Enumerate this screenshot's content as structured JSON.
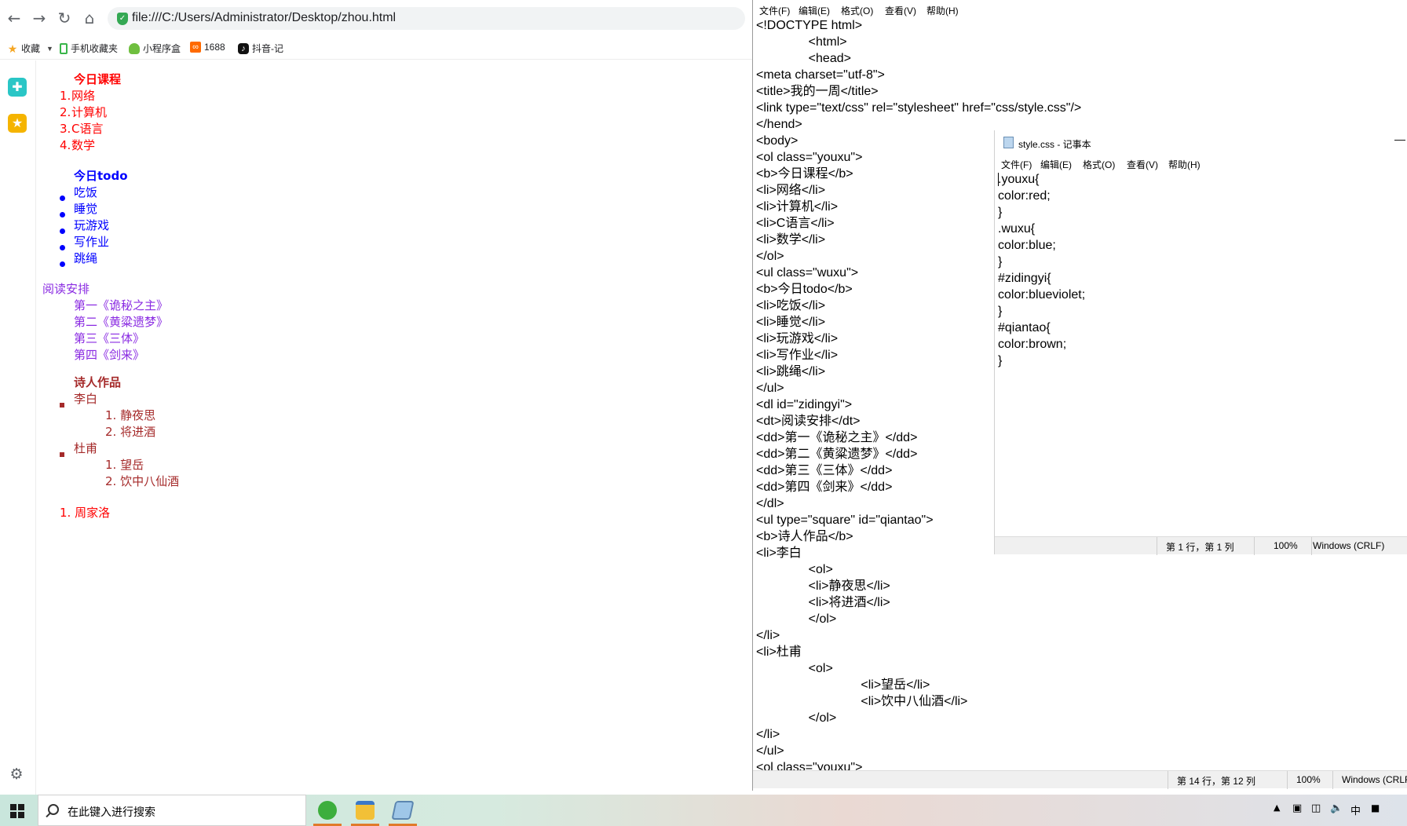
{
  "browser": {
    "url": "file:///C:/Users/Administrator/Desktop/zhou.html",
    "bookmarks": [
      "收藏",
      "手机收藏夹",
      "小程序盒",
      "1688",
      "抖音-记"
    ]
  },
  "rendered": {
    "course": {
      "title": "今日课程",
      "items": [
        {
          "marker": "1.",
          "text": "网络"
        },
        {
          "marker": "2.",
          "text": "计算机"
        },
        {
          "marker": "3.",
          "text": "C语言"
        },
        {
          "marker": "4.",
          "text": "数学"
        }
      ]
    },
    "todo": {
      "title": "今日todo",
      "items": [
        "吃饭",
        "睡觉",
        "玩游戏",
        "写作业",
        "跳绳"
      ]
    },
    "reading": {
      "title": "阅读安排",
      "items": [
        "第一《诡秘之主》",
        "第二《黄粱遗梦》",
        "第三《三体》",
        "第四《剑来》"
      ]
    },
    "poets": {
      "title": "诗人作品",
      "poet1": {
        "name": "李白",
        "works": [
          {
            "marker": "1.",
            "text": "静夜思"
          },
          {
            "marker": "2.",
            "text": "将进酒"
          }
        ]
      },
      "poet2": {
        "name": "杜甫",
        "works": [
          {
            "marker": "1.",
            "text": "望岳"
          },
          {
            "marker": "2.",
            "text": "饮中八仙酒"
          }
        ]
      }
    },
    "last": {
      "marker": "1.",
      "text": "周家洛"
    }
  },
  "notepad_main": {
    "menu": [
      "文件(F)",
      "编辑(E)",
      "格式(O)",
      "查看(V)",
      "帮助(H)"
    ],
    "lines": [
      "<!DOCTYPE html>",
      "               <html>",
      "               <head>",
      "<meta charset=\"utf-8\">",
      "<title>我的一周</title>",
      "<link type=\"text/css\" rel=\"stylesheet\" href=\"css/style.css\"/>",
      "</hend>",
      "<body>",
      "<ol class=\"youxu\">",
      "<b>今日课程</b>",
      "<li>网络</li>",
      "<li>计算机</li>",
      "<li>C语言</li>",
      "<li>数学</li>",
      "</ol>",
      "<ul class=\"wuxu\">",
      "<b>今日todo</b>",
      "<li>吃饭</li>",
      "<li>睡觉</li>",
      "<li>玩游戏</li>",
      "<li>写作业</li>",
      "<li>跳绳</li>",
      "</ul>",
      "<dl id=\"zidingyi\">",
      "<dt>阅读安排</dt>",
      "<dd>第一《诡秘之主》</dd>",
      "<dd>第二《黄粱遗梦》</dd>",
      "<dd>第三《三体》</dd>",
      "<dd>第四《剑来》</dd>",
      "</dl>",
      "<ul type=\"square\" id=\"qiantao\">",
      "<b>诗人作品</b>",
      "<li>李白",
      "               <ol>",
      "               <li>静夜思</li>",
      "               <li>将进酒</li>",
      "               </ol>",
      "</li>",
      "<li>杜甫",
      "               <ol>",
      "                              <li>望岳</li>",
      "                              <li>饮中八仙酒</li>",
      "               </ol>",
      "</li>",
      "</ul>",
      "<ol class=\"youxu\">"
    ],
    "status": {
      "position": "第 14 行，第 12 列",
      "zoom": "100%",
      "eol": "Windows (CRLF)"
    }
  },
  "notepad_css": {
    "title": "style.css - 记事本",
    "menu": [
      "文件(F)",
      "编辑(E)",
      "格式(O)",
      "查看(V)",
      "帮助(H)"
    ],
    "lines": [
      ".youxu{",
      "color:red;",
      "}",
      ".wuxu{",
      "color:blue;",
      "}",
      "#zidingyi{",
      "color:blueviolet;",
      "}",
      "#qiantao{",
      "color:brown;",
      "}"
    ],
    "status": {
      "position": "第 1 行，第 1 列",
      "zoom": "100%",
      "eol": "Windows (CRLF)"
    }
  },
  "taskbar": {
    "search_placeholder": "在此键入进行搜索",
    "ime": "中"
  },
  "colors": {
    "youxu": "#ff0000",
    "wuxu": "#0000ff",
    "zidingyi": "#8a2be2",
    "qiantao": "#a52a2a"
  }
}
